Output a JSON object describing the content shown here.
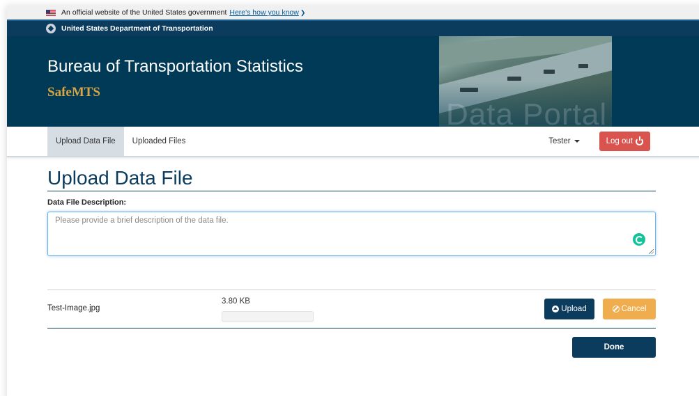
{
  "gov_banner": {
    "text": "An official website of the United States government",
    "link": "Here's how you know"
  },
  "agency_bar": {
    "text": "United States Department of Transportation"
  },
  "hero": {
    "title": "Bureau of Transportation Statistics",
    "subtitle": "SafeMTS",
    "image_caption": "Data Portal"
  },
  "nav": {
    "tabs": [
      {
        "label": "Upload Data File",
        "active": true
      },
      {
        "label": "Uploaded Files",
        "active": false
      }
    ],
    "user": "Tester",
    "logout_label": "Log out"
  },
  "main": {
    "title": "Upload Data File",
    "description_label": "Data File Description:",
    "description_placeholder": "Please provide a brief description of the data file.",
    "description_value": ""
  },
  "file": {
    "name": "Test-Image.jpg",
    "size": "3.80 KB",
    "progress_percent": 0,
    "upload_label": "Upload",
    "cancel_label": "Cancel"
  },
  "done_label": "Done",
  "colors": {
    "primary": "#0b3b5d",
    "hero_bg": "#003a57",
    "accent_gold": "#d9a441",
    "logout_red": "#d9534f",
    "cancel_orange": "#f0ad4e"
  }
}
